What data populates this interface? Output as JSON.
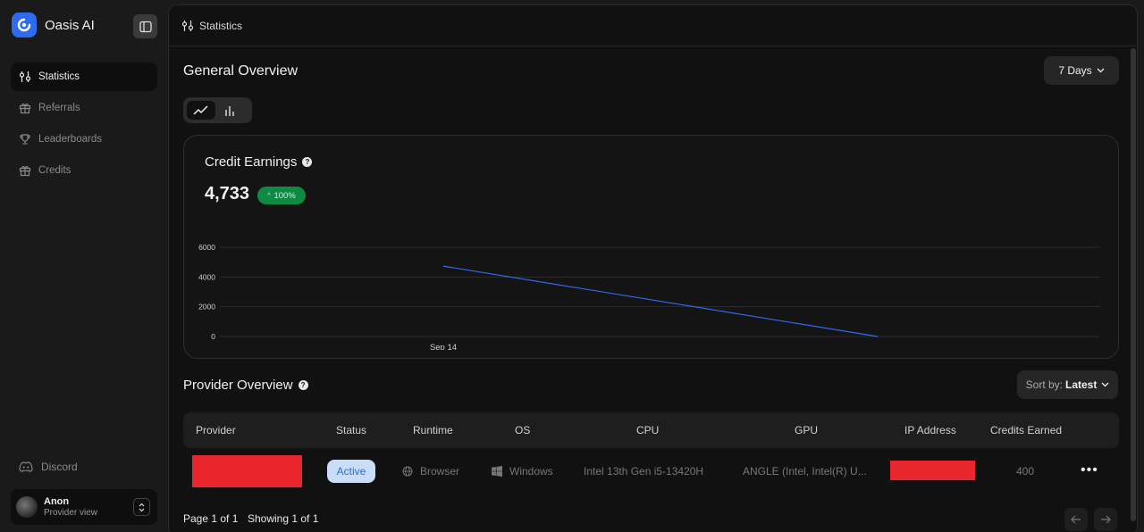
{
  "app": {
    "name": "Oasis AI",
    "accent": "#2f6bf0"
  },
  "sidebar": {
    "items": [
      {
        "label": "Statistics",
        "icon": "statistics-icon",
        "active": true
      },
      {
        "label": "Referrals",
        "icon": "gift-icon",
        "active": false
      },
      {
        "label": "Leaderboards",
        "icon": "trophy-icon",
        "active": false
      },
      {
        "label": "Credits",
        "icon": "gift-icon",
        "active": false
      }
    ],
    "discord": "Discord",
    "user": {
      "name": "Anon",
      "role": "Provider view"
    }
  },
  "header": {
    "breadcrumb": "Statistics"
  },
  "overview": {
    "title": "General Overview",
    "range": "7 Days",
    "chart_toggle": [
      "line-chart-icon",
      "bar-chart-icon"
    ]
  },
  "credit_card": {
    "title": "Credit Earnings",
    "value": "4,733",
    "change": "100%",
    "change_color": "#0f8a45"
  },
  "chart_data": {
    "type": "line",
    "title": "",
    "xlabel": "",
    "ylabel": "",
    "x_tick_labels": [
      "Sep 14"
    ],
    "y_ticks": [
      0,
      2000,
      4000,
      6000
    ],
    "ylim": [
      0,
      6000
    ],
    "series": [
      {
        "values": [
          4733,
          0
        ],
        "color": "#2f6bf0"
      }
    ],
    "grid": true
  },
  "providers": {
    "title": "Provider Overview",
    "sort_label": "Sort by:",
    "sort_value": "Latest",
    "columns": [
      "Provider",
      "Status",
      "Runtime",
      "OS",
      "CPU",
      "GPU",
      "IP Address",
      "Credits Earned"
    ],
    "rows": [
      {
        "status": "Active",
        "runtime": "Browser",
        "os": "Windows",
        "cpu": "Intel 13th Gen i5-13420H",
        "gpu": "ANGLE (Intel, Intel(R) U...",
        "credits": "400"
      }
    ],
    "page_text": "Page 1 of 1",
    "showing_text": "Showing 1 of 1"
  }
}
